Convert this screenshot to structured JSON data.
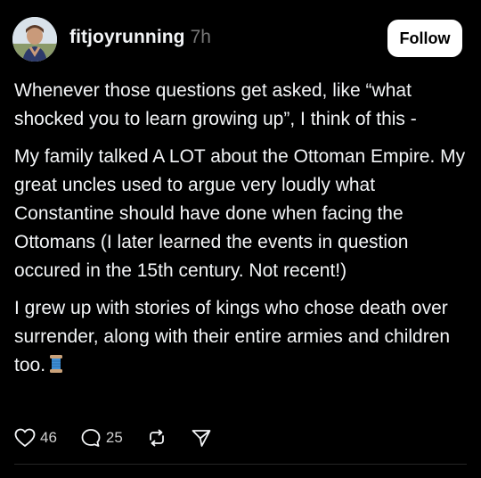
{
  "post": {
    "username": "fitjoyrunning",
    "time": "7h",
    "follow_label": "Follow",
    "paragraphs": [
      "Whenever those questions get asked, like “what shocked you to learn growing up”, I think of this -",
      "My family talked A LOT about the Ottoman Empire. My great uncles used to argue very loudly what Constantine should have done when facing the Ottomans (I later learned the events in question occured in the 15th century. Not recent!)",
      "I grew up with stories of kings who chose death over surrender, along with their entire armies and children too."
    ],
    "emoji_icon": "thread-spool-icon",
    "actions": {
      "likes": "46",
      "comments": "25",
      "like_icon": "heart-icon",
      "comment_icon": "comment-icon",
      "repost_icon": "repost-icon",
      "share_icon": "share-icon"
    }
  },
  "colors": {
    "background": "#000000",
    "text": "#f3f5f7",
    "muted": "#777777",
    "button_bg": "#ffffff",
    "button_text": "#000000"
  }
}
